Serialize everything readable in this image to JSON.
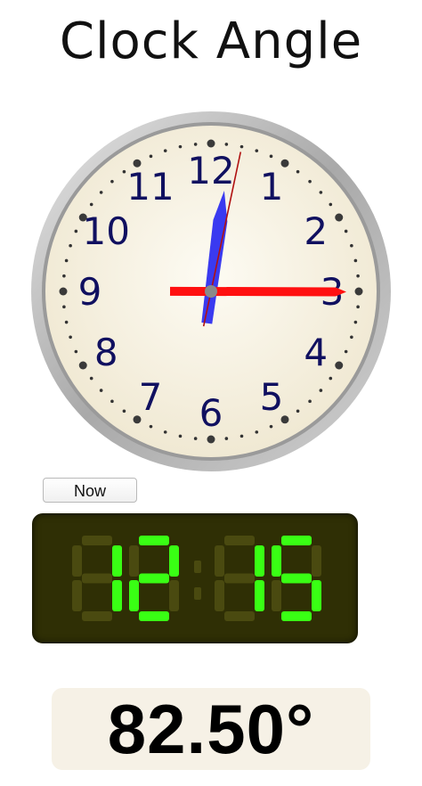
{
  "title": "Clock Angle",
  "clock": {
    "numerals": [
      "12",
      "1",
      "2",
      "3",
      "4",
      "5",
      "6",
      "7",
      "8",
      "9",
      "10",
      "11"
    ],
    "hour": 12,
    "minute": 15,
    "second": 2,
    "colors": {
      "rim": "#b8b8b8",
      "face": "#f7f2e3",
      "numerals": "#101060",
      "hour_hand": "#3a3af0",
      "minute_hand": "#ff1010",
      "second_hand": "#b01010"
    }
  },
  "now_button": {
    "label": "Now"
  },
  "digital": {
    "hours": "12",
    "minutes": "15",
    "on_color": "#39ff14",
    "off_color": "#4a4a10"
  },
  "angle": {
    "value": "82.50°"
  }
}
